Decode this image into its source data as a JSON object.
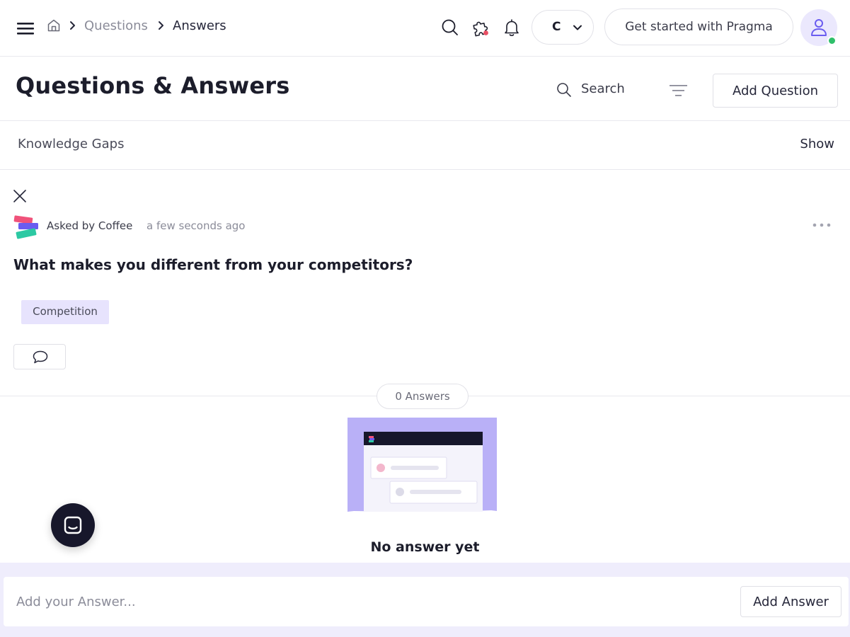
{
  "topbar": {
    "breadcrumb": [
      "Questions",
      "Answers"
    ],
    "workspace_initial": "C",
    "get_started_label": "Get started with Pragma",
    "notification_dot_color": "#e94f64",
    "status_color": "#2fbf6a"
  },
  "header": {
    "title": "Questions & Answers",
    "search_label": "Search",
    "add_question_label": "Add Question"
  },
  "knowledge_gaps": {
    "label": "Knowledge Gaps",
    "toggle_label": "Show"
  },
  "question": {
    "asked_by": "Asked by Coffee",
    "time": "a few seconds ago",
    "title": "What makes you different from your competitors?",
    "tags": [
      "Competition"
    ]
  },
  "answers": {
    "count_label": "0 Answers",
    "empty_label": "No answer yet"
  },
  "answer_bar": {
    "placeholder": "Add your Answer...",
    "submit_label": "Add Answer"
  },
  "colors": {
    "accent": "#7a6bf0",
    "tag_bg": "#e7e3fd",
    "answer_bar_bg": "#efedfc",
    "chat_launcher": "#17172b"
  }
}
